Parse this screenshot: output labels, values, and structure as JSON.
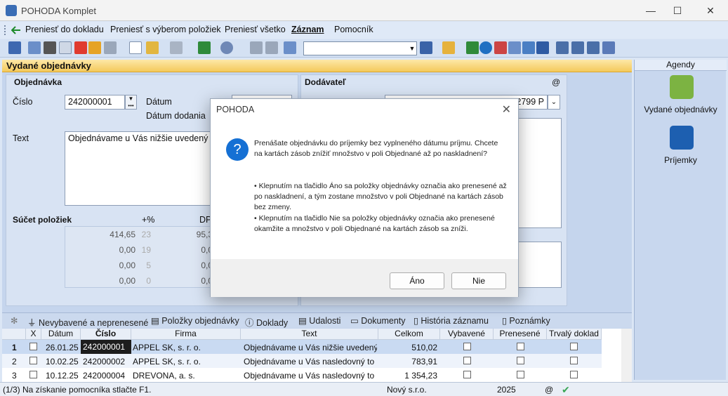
{
  "window": {
    "title": "POHODA Komplet",
    "minimize": "—",
    "maximize": "☐",
    "close": "✕"
  },
  "menu": {
    "items": [
      "Preniesť do dokladu",
      "Preniesť s výberom položiek",
      "Preniesť všetko",
      "Záznam",
      "Pomocník"
    ]
  },
  "agenda": {
    "title": "Vydané objednávky"
  },
  "form": {
    "objednavka_label": "Objednávka",
    "dodavatel_label": "Dodávateľ",
    "at_sign": "@",
    "cislo_label": "Číslo",
    "cislo_value": "242000001",
    "datum_label": "Dátum",
    "datum_dodania_label": "Dátum dodania",
    "text_label": "Text",
    "text_value": "Objednávame u Vás nižšie uvedený tov",
    "ico_partial": "22799 P",
    "sucet_label": "Súčet položiek",
    "plus_pct": "+%",
    "dph_partial": "DP",
    "sum_rows": [
      {
        "amount": "414,65",
        "rate": "23",
        "dph": "95,3"
      },
      {
        "amount": "0,00",
        "rate": "19",
        "dph": "0,0"
      },
      {
        "amount": "0,00",
        "rate": "5",
        "dph": "0,0"
      },
      {
        "amount": "0,00",
        "rate": "0",
        "dph": "0,0"
      }
    ]
  },
  "agendy": {
    "title": "Agendy",
    "items": [
      {
        "label": "Vydané objednávky"
      },
      {
        "label": "Príjemky"
      }
    ]
  },
  "tabs": [
    "Nevybavené a neprenesené",
    "Položky objednávky",
    "Doklady",
    "Udalosti",
    "Dokumenty",
    "História záznamu",
    "Poznámky"
  ],
  "grid": {
    "headers": [
      "X",
      "Dátum",
      "Číslo",
      "Firma",
      "Text",
      "Celkom",
      "Vybavené",
      "Prenesené",
      "Trvalý doklad"
    ],
    "rows": [
      {
        "n": "1",
        "datum": "26.01.25",
        "cislo": "242000001",
        "firma": "APPEL SK, s. r. o.",
        "text": "Objednávame u Vás nižšie uvedený",
        "celkom": "510,02"
      },
      {
        "n": "2",
        "datum": "10.02.25",
        "cislo": "242000002",
        "firma": "APPEL SK, s. r. o.",
        "text": "Objednávame u Vás nasledovný to",
        "celkom": "783,91"
      },
      {
        "n": "3",
        "datum": "10.12.25",
        "cislo": "242000004",
        "firma": "DREVONA, a. s.",
        "text": "Objednávame u Vás nasledovný to",
        "celkom": "1 354,23"
      }
    ]
  },
  "status": {
    "hint": "(1/3) Na získanie pomocníka stlačte F1.",
    "company": "Nový s.r.o.",
    "year": "2025",
    "at": "@"
  },
  "dialog": {
    "title": "POHODA",
    "q": "?",
    "p1": "Prenášate objednávku do príjemky bez vyplneného dátumu príjmu. Chcete na kartách zásob znížiť množstvo v poli Objednané až po naskladnení?",
    "p2": "• Klepnutím na tlačidlo Áno sa položky objednávky označia ako prenesené až po naskladnení, a tým zostane množstvo v poli Objednané na kartách zásob bez zmeny.",
    "p3": "• Klepnutím na tlačidlo Nie sa položky objednávky označia ako prenesené okamžite a množstvo v poli Objednané na kartách zásob sa zníži.",
    "yes": "Áno",
    "no": "Nie"
  }
}
